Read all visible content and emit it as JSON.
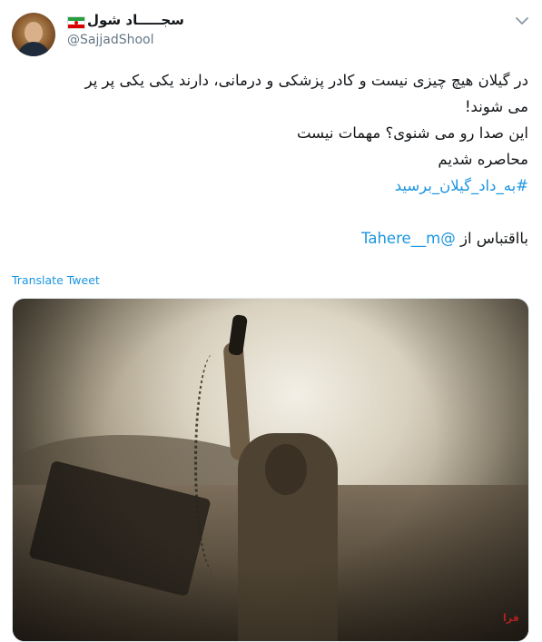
{
  "author": {
    "display_name": "سجـــــاد شول",
    "handle": "@SajjadShool",
    "flag_icon": "iran-flag-icon",
    "avatar_icon": "avatar"
  },
  "menu": {
    "caret_icon": "chevron-down-icon"
  },
  "tweet": {
    "lines": [
      "در گیلان هیچ چیزی نیست و کادر پزشکی و درمانی، دارند یکی یکی پر پر",
      "می شوند!",
      "این صدا رو می شنوی؟ مهمات نیست",
      "محاصره شدیم"
    ],
    "hashtag": "#به_داد_گیلان_برسید",
    "quote_prefix": "بااقتباس از",
    "mention": "@Tahere__m"
  },
  "translate_label": "Translate Tweet",
  "media": {
    "watermark": "فرا"
  },
  "colors": {
    "link": "#1b95e0",
    "secondary_text": "#657786",
    "text": "#14171a"
  }
}
